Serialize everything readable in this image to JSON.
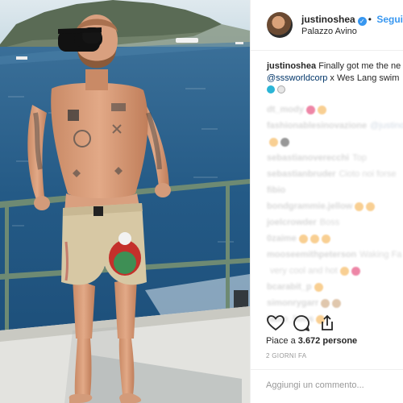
{
  "header": {
    "username": "justinoshea",
    "verified_icon": "verified-badge-icon",
    "separator": "•",
    "follow_label": "Segui",
    "location": "Palazzo Avino"
  },
  "caption": {
    "username": "justinoshea",
    "text": "Finally got me the ne",
    "mention": "@sssworldcorp",
    "text2": "x Wes Lang swim"
  },
  "comments": [
    {
      "name": "dt_mody",
      "text": "",
      "emoji": [
        "#e0245e",
        "#f4a93b"
      ]
    },
    {
      "name": "fashionablesinovazione",
      "text": "@justino",
      "link": true,
      "emoji": []
    },
    {
      "name": "",
      "text": "",
      "emoji": [
        "#f4a93b",
        "#444444"
      ]
    },
    {
      "name": "sebastianoverecchi",
      "text": "Top",
      "emoji": []
    },
    {
      "name": "sebastianbruder",
      "text": "Cioto noi forse",
      "emoji": []
    },
    {
      "name": "fibio",
      "text": "",
      "emoji": []
    },
    {
      "name": "bondgrammie.jellow",
      "text": "",
      "emoji": [
        "#f4a93b",
        "#f4a93b"
      ]
    },
    {
      "name": "joelcrowder",
      "text": "Boss",
      "emoji": []
    },
    {
      "name": "0zaime",
      "text": "",
      "emoji": [
        "#f4a93b",
        "#f4a93b",
        "#f4a93b"
      ]
    },
    {
      "name": "mooseemithpeterson",
      "text": "Waking Fa",
      "emoji": []
    },
    {
      "name": "",
      "text": "very cool and hot",
      "emoji": [
        "#f4a93b",
        "#e0245e"
      ]
    },
    {
      "name": "bcarabit_p",
      "text": "",
      "emoji": [
        "#f4a93b"
      ]
    },
    {
      "name": "simonrygarr",
      "text": "",
      "emoji": [
        "#c79a6b",
        "#c79a6b"
      ]
    },
    {
      "name": "fabio_lions",
      "text": "",
      "emoji": [
        "#f4a93b"
      ]
    }
  ],
  "actions": {
    "like_icon": "heart-icon",
    "comment_icon": "comment-icon",
    "share_icon": "share-icon"
  },
  "likes": {
    "prefix": "Piace a",
    "count": "3.672",
    "suffix": "persone"
  },
  "date": "2 GIORNI FA",
  "add_comment": {
    "placeholder": "Aggiungi un commento..."
  },
  "colors": {
    "accent": "#3897f0",
    "text": "#262626",
    "muted": "#999999",
    "border": "#efefef",
    "mention": "#003569"
  }
}
